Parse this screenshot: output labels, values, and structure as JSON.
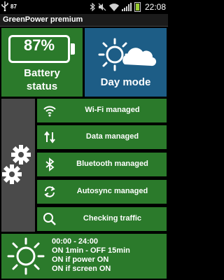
{
  "status_bar": {
    "notification_badge": "87",
    "time": "22:08"
  },
  "app": {
    "title": "GreenPower premium"
  },
  "battery": {
    "percent_label": "87%",
    "label_line1": "Battery",
    "label_line2": "status",
    "level": 0.87
  },
  "mode": {
    "label": "Day mode"
  },
  "toggles": [
    {
      "label": "Wi-Fi managed",
      "icon": "wifi-icon"
    },
    {
      "label": "Data managed",
      "icon": "data-arrows-icon"
    },
    {
      "label": "Bluetooth managed",
      "icon": "bluetooth-icon"
    },
    {
      "label": "Autosync managed",
      "icon": "sync-icon"
    },
    {
      "label": "Checking traffic",
      "icon": "search-icon"
    }
  ],
  "schedule": {
    "lines": [
      "00:00 - 24:00",
      "ON 1min - OFF 15min",
      "ON if power ON",
      "ON if screen ON"
    ]
  },
  "colors": {
    "tile_green": "#2b7a2b",
    "tile_blue": "#1d5d86",
    "tile_gray": "#4a4a4a"
  }
}
